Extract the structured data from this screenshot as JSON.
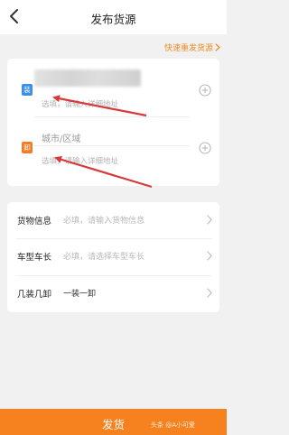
{
  "header": {
    "title": "发布货源",
    "back_icon": "chevron-left-icon"
  },
  "quick_republish": {
    "label": "快速重发货源",
    "icon": "chevron-right-icon"
  },
  "address_card": {
    "loading": {
      "badge": "装",
      "badge_color": "#3c8ee8",
      "hint": "选填，请输入详细地址"
    },
    "unloading": {
      "badge": "卸",
      "badge_color": "#f27d26",
      "city_placeholder": "城市/区域",
      "hint": "选填，请输入详细地址"
    }
  },
  "form": {
    "rows": [
      {
        "label": "货物信息",
        "value": "必填，请输入货物信息"
      },
      {
        "label": "车型车长",
        "value": "必填，请选择车型车长"
      },
      {
        "label": "几装几卸",
        "value": "一装一卸"
      }
    ]
  },
  "submit": {
    "label": "发货",
    "color": "#f5821f"
  },
  "watermark": "头条 @A小可爱",
  "annotation_color": "#d63a3a"
}
